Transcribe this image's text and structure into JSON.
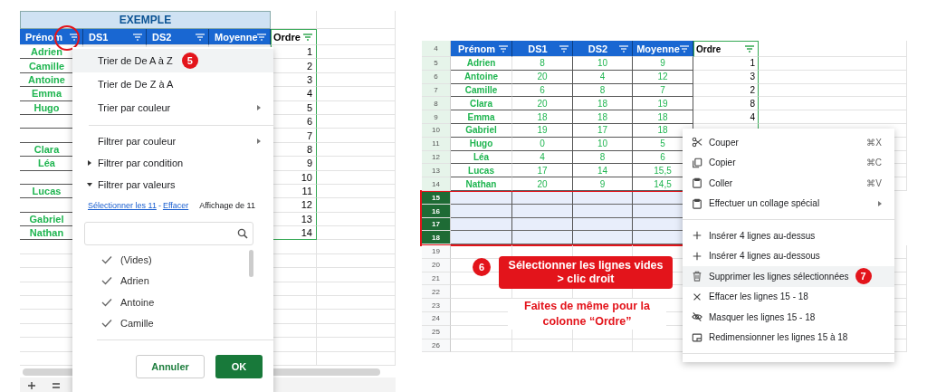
{
  "left_sheet": {
    "title": "EXEMPLE",
    "columns": [
      {
        "label": "Prénom",
        "circled": true
      },
      {
        "label": "DS1",
        "circled": false
      },
      {
        "label": "DS2",
        "circled": false
      },
      {
        "label": "Moyenne",
        "circled": false
      },
      {
        "label": "Ordre",
        "circled": false
      }
    ],
    "rows": [
      {
        "name": "Adrien",
        "ordre": "1"
      },
      {
        "name": "Camille",
        "ordre": "2"
      },
      {
        "name": "Antoine",
        "ordre": "3"
      },
      {
        "name": "Emma",
        "ordre": "4"
      },
      {
        "name": "Hugo",
        "ordre": "5"
      },
      {
        "ordre": "6"
      },
      {
        "ordre": "7"
      },
      {
        "name": "Clara",
        "ordre": "8"
      },
      {
        "name": "Léa",
        "ordre": "9"
      },
      {
        "ordre": "10"
      },
      {
        "name": "Lucas",
        "ordre": "11"
      },
      {
        "ordre": "12"
      },
      {
        "name": "Gabriel",
        "ordre": "13"
      },
      {
        "name": "Nathan",
        "ordre": "14"
      }
    ],
    "filter_menu": {
      "sort_items": [
        {
          "label": "Trier de De A à Z",
          "selected": true,
          "submenu": false,
          "step": "5"
        },
        {
          "label": "Trier de De Z à A",
          "selected": false,
          "submenu": false
        },
        {
          "label": "Trier par couleur",
          "selected": false,
          "submenu": true
        }
      ],
      "filter_items": [
        {
          "label": "Filtrer par couleur",
          "kind": "submenu"
        },
        {
          "label": "Filtrer par condition",
          "kind": "section",
          "expanded": false
        },
        {
          "label": "Filtrer par valeurs",
          "kind": "section",
          "expanded": true
        }
      ],
      "select_all_link": "Sélectionner les 11",
      "separator": "-",
      "clear_link": "Effacer",
      "count": "Affichage de 11",
      "values": [
        {
          "label": "(Vides)",
          "checked": true
        },
        {
          "label": "Adrien",
          "checked": true
        },
        {
          "label": "Antoine",
          "checked": true
        },
        {
          "label": "Camille",
          "checked": true
        }
      ],
      "cancel_button": "Annuler",
      "ok_button": "OK"
    }
  },
  "right_sheet": {
    "header_row": "4",
    "columns": [
      "Prénom",
      "DS1",
      "DS2",
      "Moyenne",
      "Ordre"
    ],
    "rows": [
      {
        "row": "5",
        "name": "Adrien",
        "ds1": "8",
        "ds2": "10",
        "moyenne": "9",
        "ordre": "1",
        "selected": false
      },
      {
        "row": "6",
        "name": "Antoine",
        "ds1": "20",
        "ds2": "4",
        "moyenne": "12",
        "ordre": "3",
        "selected": false
      },
      {
        "row": "7",
        "name": "Camille",
        "ds1": "6",
        "ds2": "8",
        "moyenne": "7",
        "ordre": "2",
        "selected": false
      },
      {
        "row": "8",
        "name": "Clara",
        "ds1": "20",
        "ds2": "18",
        "moyenne": "19",
        "ordre": "8",
        "selected": false
      },
      {
        "row": "9",
        "name": "Emma",
        "ds1": "18",
        "ds2": "18",
        "moyenne": "18",
        "ordre": "4",
        "selected": false
      },
      {
        "row": "10",
        "name": "Gabriel",
        "ds1": "19",
        "ds2": "17",
        "moyenne": "18",
        "selected": false
      },
      {
        "row": "11",
        "name": "Hugo",
        "ds1": "0",
        "ds2": "10",
        "moyenne": "5",
        "selected": false
      },
      {
        "row": "12",
        "name": "Léa",
        "ds1": "4",
        "ds2": "8",
        "moyenne": "6",
        "selected": false
      },
      {
        "row": "13",
        "name": "Lucas",
        "ds1": "17",
        "ds2": "14",
        "moyenne": "15,5",
        "selected": false
      },
      {
        "row": "14",
        "name": "Nathan",
        "ds1": "20",
        "ds2": "9",
        "moyenne": "14,5",
        "selected": false
      },
      {
        "row": "15",
        "selected": true
      },
      {
        "row": "16",
        "selected": true
      },
      {
        "row": "17",
        "selected": true
      },
      {
        "row": "18",
        "selected": true
      },
      {
        "row": "19",
        "selected": false
      },
      {
        "row": "20",
        "selected": false
      },
      {
        "row": "21",
        "selected": false
      },
      {
        "row": "22",
        "selected": false
      },
      {
        "row": "23",
        "selected": false
      },
      {
        "row": "24",
        "selected": false
      },
      {
        "row": "25",
        "selected": false
      },
      {
        "row": "26",
        "selected": false
      }
    ],
    "step_badge": "6",
    "callout": [
      "Sélectionner les lignes vides",
      "> clic droit"
    ],
    "note": [
      "Faites de même pour la",
      "colonne “Ordre”"
    ],
    "context_menu": {
      "groups": [
        [
          {
            "label": "Couper",
            "shortcut": "⌘X",
            "selected": false
          },
          {
            "label": "Copier",
            "shortcut": "⌘C",
            "selected": false
          },
          {
            "label": "Coller",
            "shortcut": "⌘V",
            "selected": false
          },
          {
            "label": "Effectuer un collage spécial",
            "submenu": true,
            "selected": false
          }
        ],
        [
          {
            "label": "Insérer 4 lignes au-dessus",
            "selected": false
          },
          {
            "label": "Insérer 4 lignes au-dessous",
            "selected": false
          },
          {
            "label": "Supprimer les lignes sélectionnées",
            "selected": true,
            "step": "7"
          },
          {
            "label": "Effacer les lignes 15 - 18",
            "selected": false
          },
          {
            "label": "Masquer les lignes 15 - 18",
            "selected": false
          },
          {
            "label": "Redimensionner les lignes 15 à 18",
            "selected": false
          }
        ]
      ]
    }
  }
}
